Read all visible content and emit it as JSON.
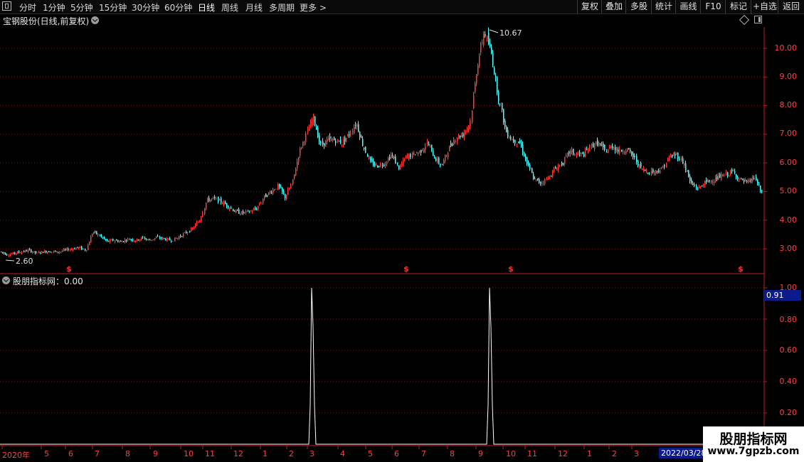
{
  "toolbar": {
    "periods": [
      "分时",
      "1分钟",
      "5分钟",
      "15分钟",
      "30分钟",
      "60分钟",
      "日线",
      "周线",
      "月线",
      "多周期",
      "更多 >"
    ],
    "active_period": "日线",
    "right_buttons": [
      "复权",
      "叠加",
      "多股",
      "统计",
      "画线",
      "F10",
      "标记",
      "+自选",
      "返回"
    ]
  },
  "chart": {
    "title": "宝钢股份(日线,前复权)",
    "high_label": "10.67",
    "low_label": "2.60",
    "y_ticks": [
      "10.00",
      "9.00",
      "8.00",
      "7.00",
      "6.00",
      "5.00",
      "4.00",
      "3.00"
    ],
    "markers": [
      "$",
      "$",
      "$",
      "$"
    ]
  },
  "indicator": {
    "title": "股朋指标网：0.00",
    "y_ticks": [
      "1.00",
      "0.80",
      "0.60",
      "0.40",
      "0.20"
    ],
    "current_value": "0.91"
  },
  "time_axis": {
    "labels": [
      "2020年",
      "5",
      "6",
      "7",
      "8",
      "9",
      "10",
      "11",
      "12",
      "1",
      "2",
      "3",
      "4",
      "5",
      "6",
      "7",
      "8",
      "9",
      "10",
      "11",
      "12",
      "1",
      "2",
      "3"
    ],
    "cursor_date": "2022/03/28"
  },
  "watermark": {
    "title": "股朋指标网",
    "url": "www.7gpzb.com"
  },
  "colors": {
    "up": "#ff3d3d",
    "down": "#54ffff",
    "axis": "#c81e1e",
    "grid": "#7a1515",
    "highlight": "#0b1a8c"
  },
  "chart_data": {
    "type": "line",
    "title": "",
    "series": [
      {
        "name": "",
        "x": [
          0,
          10,
          20,
          30,
          40,
          50,
          60,
          70,
          80,
          90,
          100,
          110,
          120,
          130,
          140,
          150,
          160,
          170,
          180,
          190,
          200,
          210,
          220,
          230,
          240,
          250,
          260,
          270,
          280,
          290,
          300,
          310,
          320,
          330,
          340,
          350,
          360,
          370,
          380,
          390,
          400,
          410,
          420,
          430,
          440,
          450,
          460,
          470,
          480,
          490,
          500,
          510,
          520,
          530,
          540,
          550,
          560,
          570,
          580,
          590,
          600,
          610,
          620,
          630,
          640,
          650,
          660,
          670,
          680,
          690,
          700,
          710,
          720,
          730,
          740,
          750,
          760,
          770,
          780,
          790,
          800,
          810,
          820,
          830,
          840,
          850,
          860,
          870,
          880,
          890,
          900,
          910,
          920,
          930,
          940,
          950,
          960,
          970,
          980,
          990,
          1000,
          1010,
          1020,
          1030,
          1040,
          1050,
          1060,
          1070
        ],
        "y": [
          2.9,
          2.8,
          2.85,
          2.9,
          2.95,
          2.85,
          2.9,
          2.92,
          2.88,
          2.95,
          3.0,
          3.05,
          2.95,
          3.6,
          3.45,
          3.25,
          3.3,
          3.25,
          3.35,
          3.3,
          3.38,
          3.3,
          3.4,
          3.35,
          3.3,
          3.4,
          3.55,
          3.7,
          4.0,
          4.7,
          4.75,
          4.65,
          4.5,
          4.3,
          4.25,
          4.3,
          4.4,
          4.8,
          5.0,
          5.2,
          4.8,
          5.3,
          6.4,
          7.0,
          7.6,
          6.6,
          6.8,
          6.8,
          6.7,
          7.0,
          7.4,
          6.6,
          6.0,
          5.9,
          6.0,
          6.3,
          5.8,
          6.2,
          6.3,
          6.4,
          6.7,
          6.2,
          5.9,
          6.5,
          6.9,
          7.0,
          7.4,
          9.4,
          10.6,
          9.8,
          8.3,
          7.1,
          6.8,
          6.7,
          6.0,
          5.4,
          5.3,
          5.5,
          5.8,
          6.0,
          6.4,
          6.3,
          6.3,
          6.6,
          6.7,
          6.4,
          6.6,
          6.4,
          6.5,
          6.2,
          5.8,
          5.7,
          5.7,
          5.8,
          6.2,
          6.3,
          6.0,
          5.3,
          5.1,
          5.3,
          5.4,
          5.5,
          5.6,
          5.7,
          5.4,
          5.3,
          5.5,
          4.9
        ]
      },
      {
        "name": "",
        "x": [
          0,
          434,
          436,
          438,
          440,
          442,
          444,
          684,
          686,
          688,
          690,
          692,
          694,
          1070
        ],
        "y": [
          0,
          0,
          0.25,
          1.0,
          0.75,
          0.25,
          0,
          0,
          0.25,
          1.0,
          0.75,
          0.25,
          0,
          0
        ]
      }
    ]
  }
}
